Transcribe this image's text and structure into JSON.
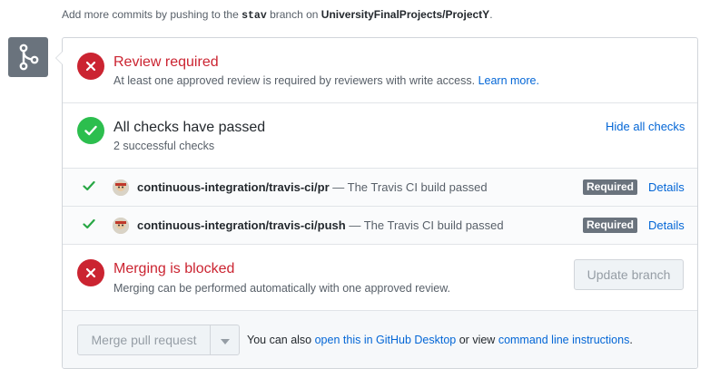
{
  "hint": {
    "prefix": "Add more commits by pushing to the",
    "branch": "stav",
    "middle": "branch on",
    "repo": "UniversityFinalProjects/ProjectY",
    "suffix": "."
  },
  "icons": {
    "merge": "git-merge-icon",
    "error": "x-icon",
    "success": "check-icon",
    "avatar": "travis-ci-avatar",
    "caret": "caret-down-icon"
  },
  "colors": {
    "error": "#cb2431",
    "success": "#2cbe4e",
    "link": "#0366d6",
    "badge": "#6a737d"
  },
  "review": {
    "title": "Review required",
    "text": "At least one approved review is required by reviewers with write access.",
    "link": "Learn more."
  },
  "checks": {
    "title": "All checks have passed",
    "subtitle": "2 successful checks",
    "toggle": "Hide all checks",
    "items": [
      {
        "context": "continuous-integration/travis-ci/pr",
        "separator": "—",
        "description": "The Travis CI build passed",
        "badge": "Required",
        "link": "Details"
      },
      {
        "context": "continuous-integration/travis-ci/push",
        "separator": "—",
        "description": "The Travis CI build passed",
        "badge": "Required",
        "link": "Details"
      }
    ]
  },
  "blocked": {
    "title": "Merging is blocked",
    "text": "Merging can be performed automatically with one approved review.",
    "button": "Update branch"
  },
  "merge": {
    "button": "Merge pull request",
    "also_prefix": "You can also",
    "desktop_link": "open this in GitHub Desktop",
    "or_view": "or view",
    "cli_link": "command line instructions",
    "suffix": "."
  }
}
